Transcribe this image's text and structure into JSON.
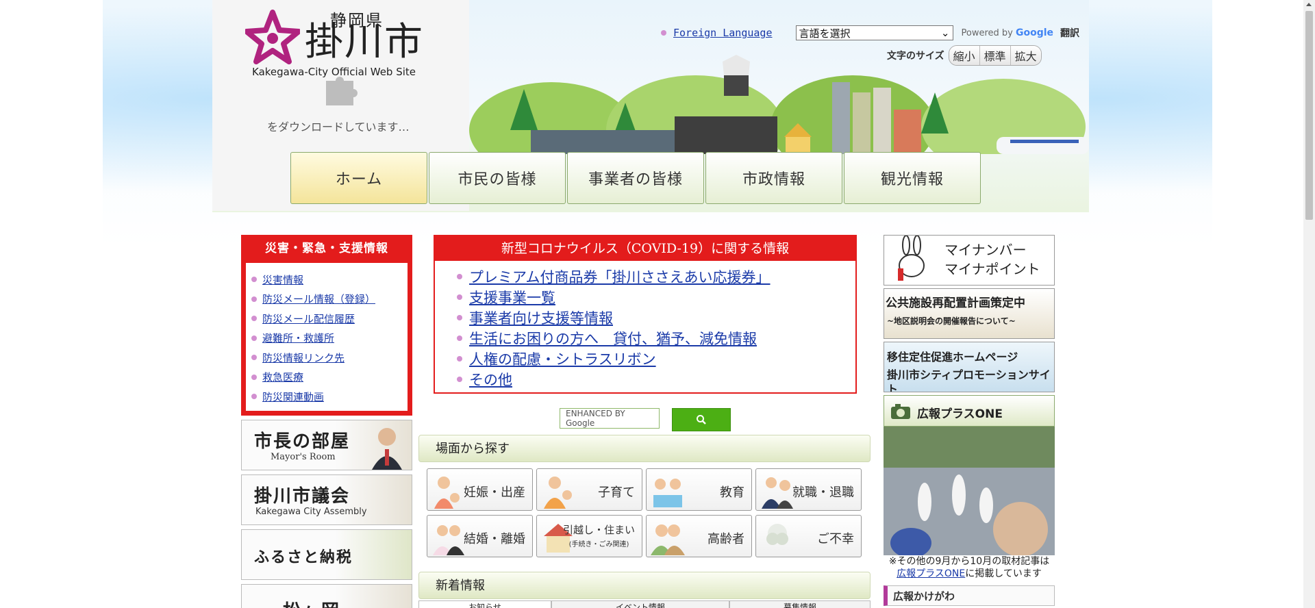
{
  "header": {
    "prefecture": "静岡県",
    "city": "掛川市",
    "official_site": "Kakegawa-City Official Web Site",
    "downloading": "をダウンロードしています…",
    "foreign_language": "Foreign Language",
    "language_select_value": "言語を選択",
    "powered_by": "Powered by",
    "google": "Google",
    "translate": "翻訳",
    "font_size_label": "文字のサイズ",
    "font_size_options": [
      "縮小",
      "標準",
      "拡大"
    ]
  },
  "nav": {
    "items": [
      "ホーム",
      "市民の皆様",
      "事業者の皆様",
      "市政情報",
      "観光情報"
    ],
    "active": 0
  },
  "disaster": {
    "title": "災害・緊急・支援情報",
    "links": [
      "災害情報",
      "防災メール情報（登録）",
      "防災メール配信履歴",
      "避難所・救護所",
      "防災情報リンク先",
      "救急医療",
      "防災関連動画"
    ]
  },
  "left_banners": {
    "mayor_title": "市長の部屋",
    "mayor_sub": "Mayor's Room",
    "assembly_title": "掛川市議会",
    "assembly_sub": "Kakegawa City Assembly",
    "furusato_title": "ふるさと納税",
    "castle_title": "松ヶ岡"
  },
  "covid": {
    "title": "新型コロナウイルス（COVID-19）に関する情報",
    "links": [
      "プレミアム付商品券「掛川ささえあい応援券」",
      "支援事業一覧",
      "事業者向け支援等情報",
      "生活にお困りの方へ　貸付、猶予、減免情報",
      "人権の配慮・シトラスリボン",
      "その他"
    ]
  },
  "search": {
    "placeholder": "ENHANCED BY Google"
  },
  "scenes": {
    "title": "場面から探す",
    "items": [
      "妊娠・出産",
      "子育て",
      "教育",
      "就職・退職",
      "結婚・離婚",
      "引越し・住まい",
      "高齢者",
      "ご不幸"
    ],
    "sub_label": "(手続き・ごみ関連)"
  },
  "news": {
    "title": "新着情報",
    "tabs": [
      "お知らせ",
      "イベント情報",
      "募集情報"
    ]
  },
  "right": {
    "mynumber_line1": "マイナンバー",
    "mynumber_line2": "マイナポイント",
    "facility_line1": "公共施設再配置計画策定中",
    "facility_line2": "~地区説明会の開催報告について~",
    "migration_line1": "移住定住促進ホームページ",
    "migration_line2": "掛川市シティプロモーションサイト",
    "koho_title": "広報プラスONE",
    "note_prefix": "※その他の9月から10月の取材記事は",
    "note_link": "広報プラスONE",
    "note_suffix": "に掲載しています",
    "koho2_title": "広報かけがわ"
  },
  "colors": {
    "accent_red": "#e31c1c",
    "link_blue": "#1a3aa8",
    "search_green": "#4caf14",
    "bullet_pink": "#d28fd0"
  }
}
